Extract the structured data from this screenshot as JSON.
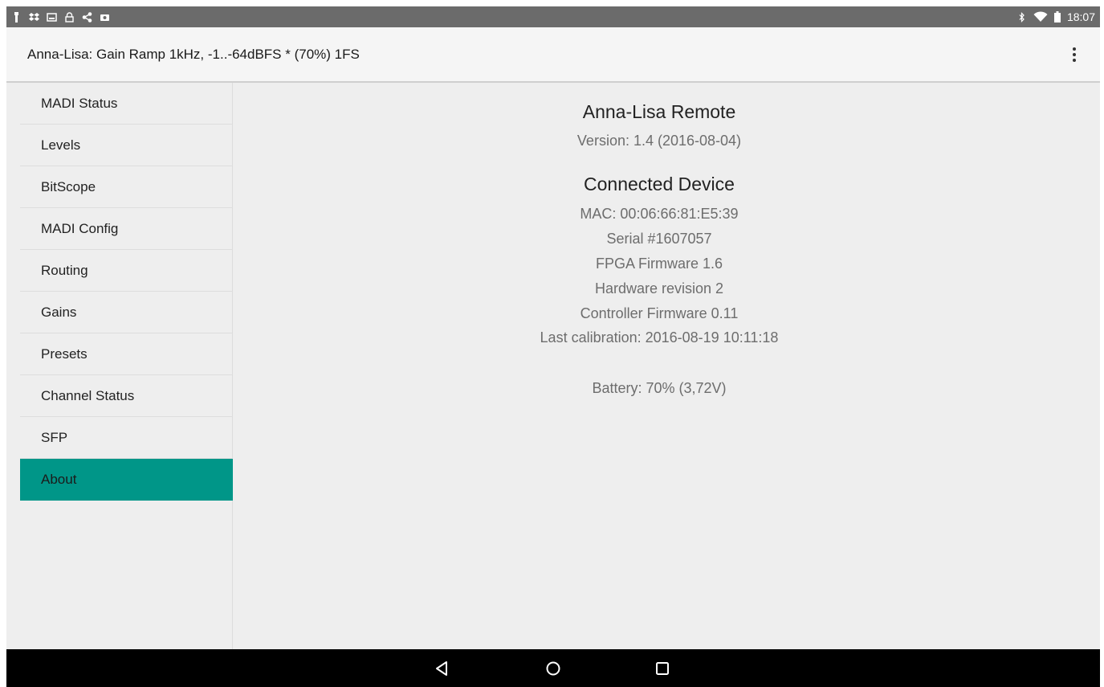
{
  "status_bar": {
    "time": "18:07",
    "left_icons": [
      "usb-debug-icon",
      "dropbox-icon",
      "image-icon",
      "lock-icon",
      "share-icon",
      "photo-icon"
    ],
    "right_icons": [
      "bluetooth-icon",
      "wifi-icon",
      "battery-icon"
    ]
  },
  "toolbar": {
    "title": "Anna-Lisa: Gain Ramp 1kHz, -1..-64dBFS * (70%) 1FS",
    "menu_icon": "more-vert-icon"
  },
  "sidebar": {
    "items": [
      {
        "label": "MADI Status"
      },
      {
        "label": "Levels"
      },
      {
        "label": "BitScope"
      },
      {
        "label": "MADI Config"
      },
      {
        "label": "Routing"
      },
      {
        "label": "Gains"
      },
      {
        "label": "Presets"
      },
      {
        "label": "Channel Status"
      },
      {
        "label": "SFP"
      },
      {
        "label": "About"
      }
    ],
    "selected": "About"
  },
  "about": {
    "app_title": "Anna-Lisa Remote",
    "version": "Version: 1.4 (2016-08-04)",
    "device_title": "Connected Device",
    "mac": "MAC: 00:06:66:81:E5:39",
    "serial": "Serial #1607057",
    "fpga": "FPGA Firmware 1.6",
    "hardware": "Hardware revision 2",
    "controller": "Controller Firmware 0.11",
    "calibration": "Last calibration: 2016-08-19 10:11:18",
    "battery": "Battery: 70% (3,72V)"
  },
  "nav_bar": {
    "buttons": [
      "back-icon",
      "home-icon",
      "recents-icon"
    ]
  },
  "colors": {
    "accent": "#009688",
    "status_bar": "#6b6b6b",
    "background": "#eeeeee",
    "nav_bar": "#000000"
  }
}
